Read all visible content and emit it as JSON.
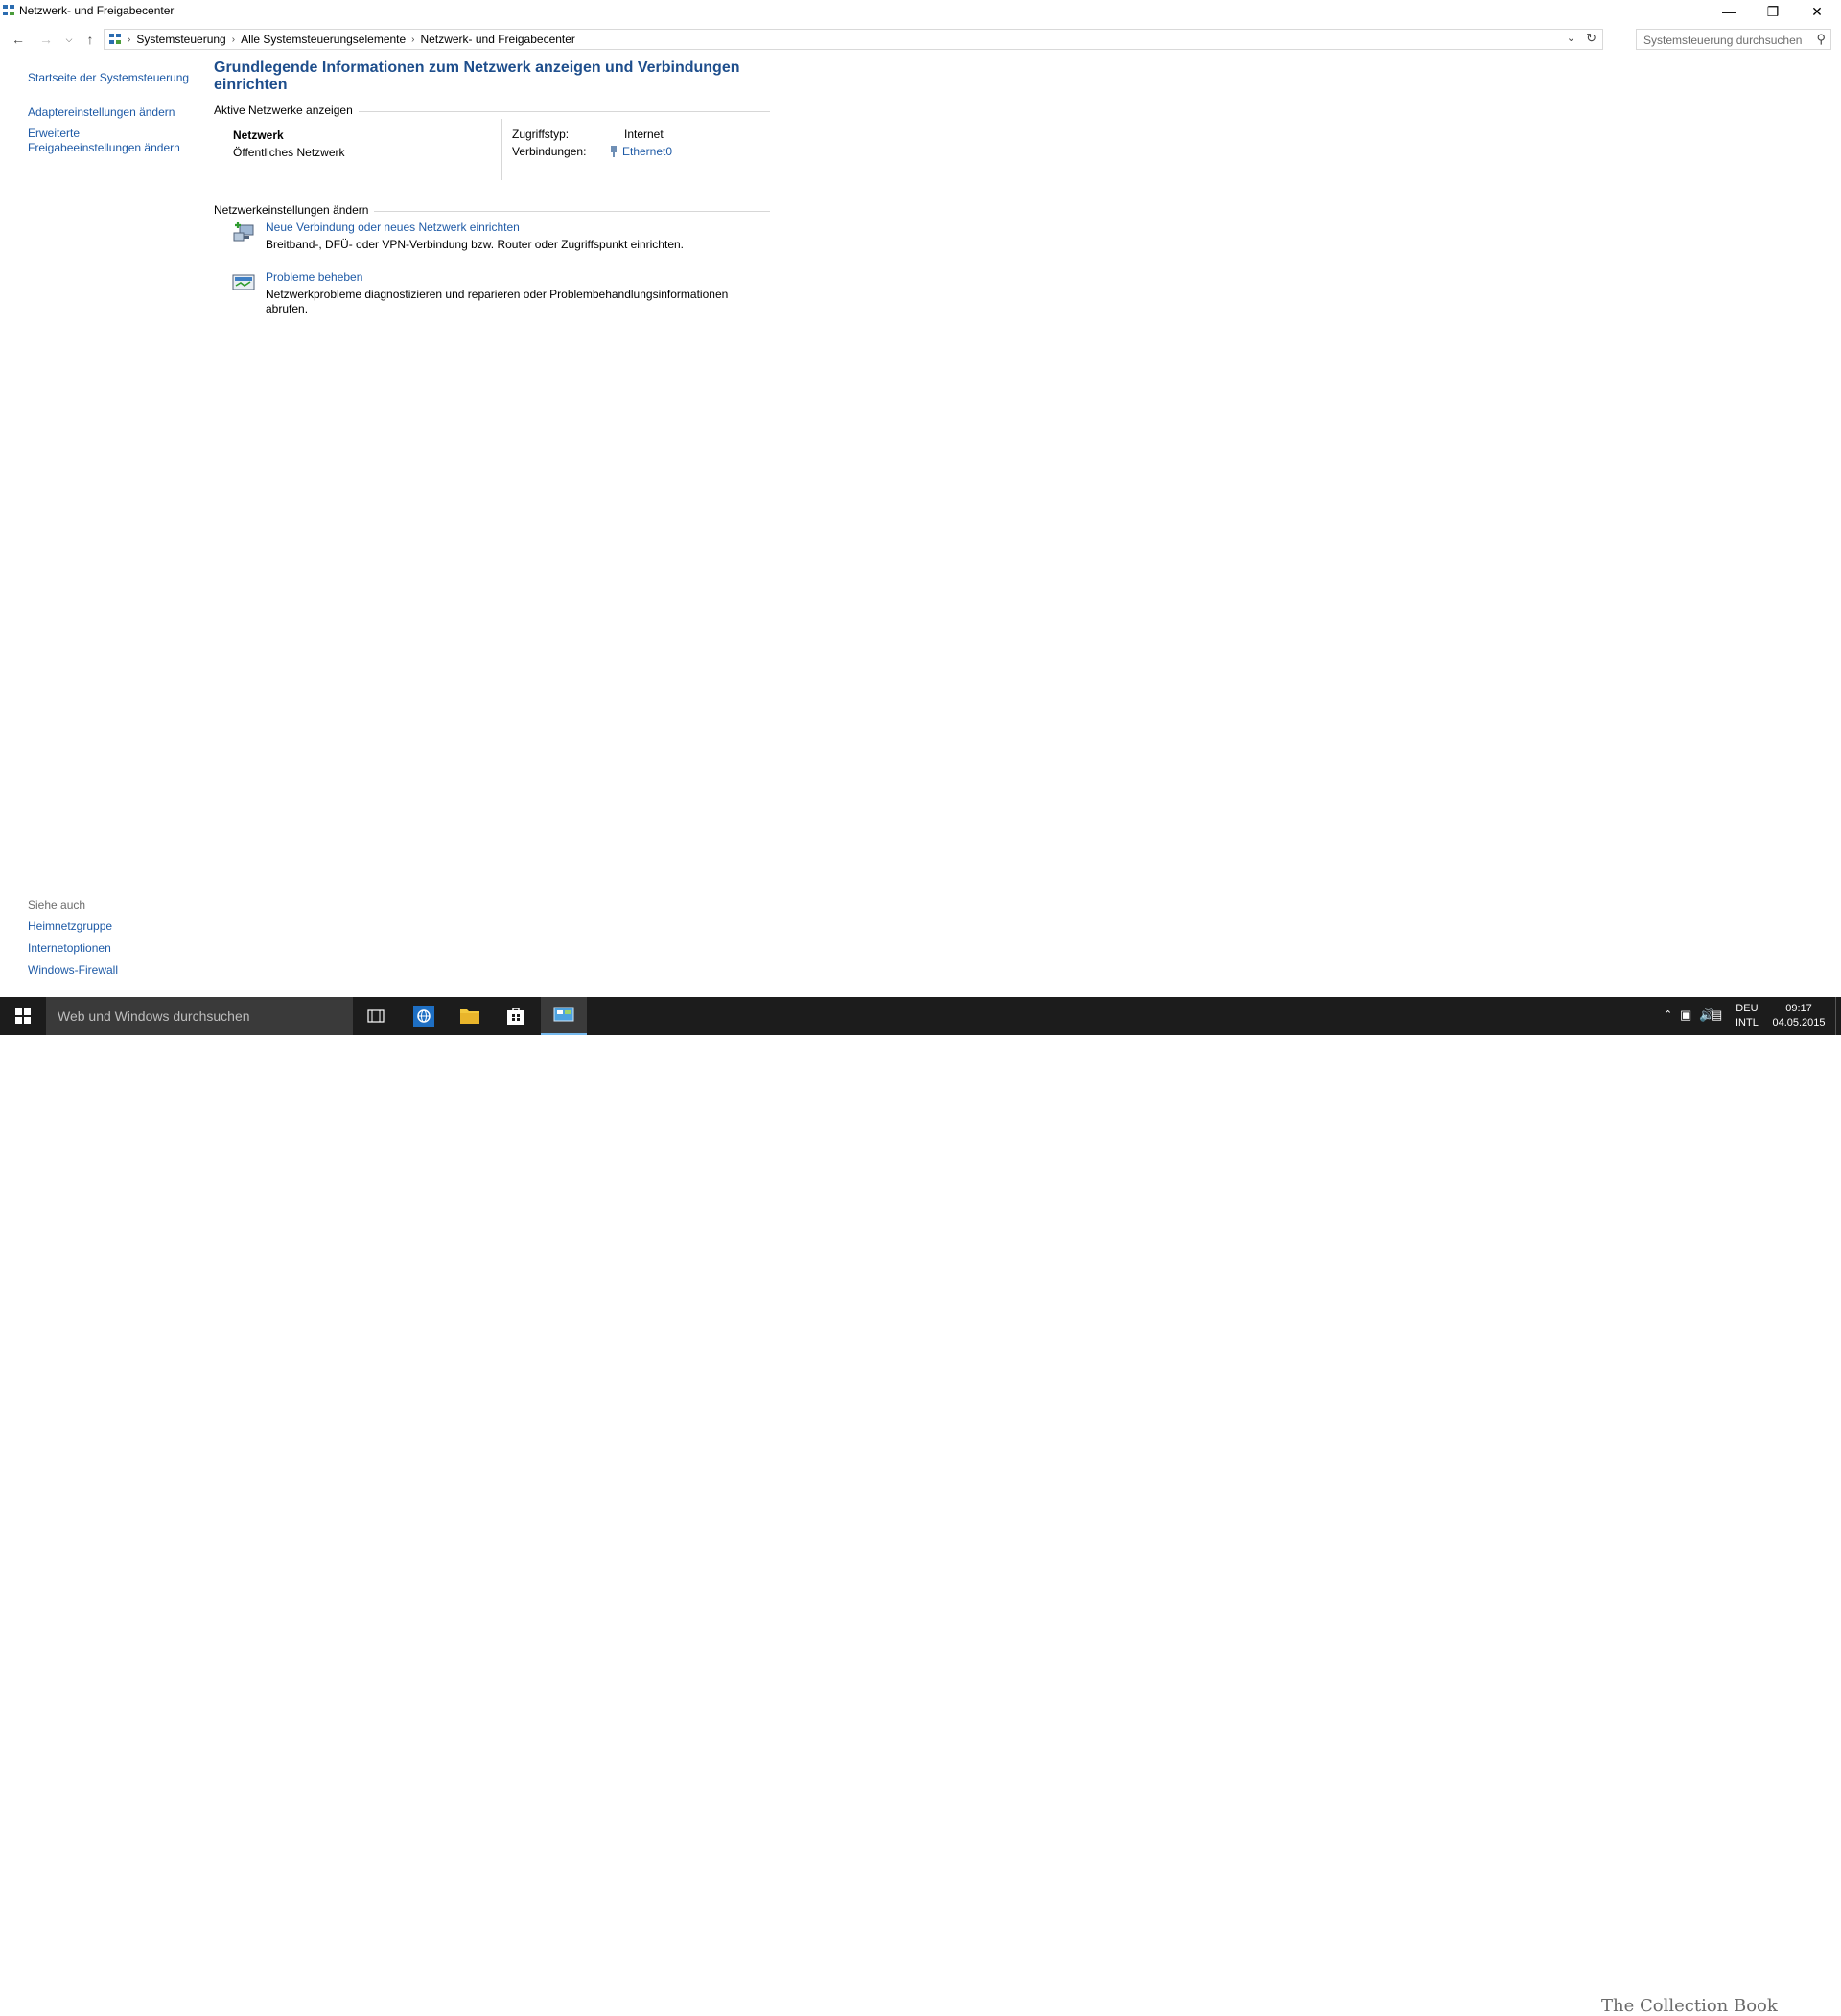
{
  "window": {
    "title": "Netzwerk- und Freigabecenter",
    "controls": [
      "minimize-icon",
      "restore-icon",
      "close-icon"
    ]
  },
  "address": {
    "crumbs": [
      "Systemsteuerung",
      "Alle Systemsteuerungselemente",
      "Netzwerk- und Freigabecenter"
    ],
    "search_placeholder": "Systemsteuerung durchsuchen"
  },
  "left_pane": {
    "links": [
      "Startseite der Systemsteuerung",
      "Adaptereinstellungen ändern",
      "Erweiterte Freigabeeinstellungen ändern"
    ],
    "see_also_header": "Siehe auch",
    "see_also": [
      "Heimnetzgruppe",
      "Internetoptionen",
      "Windows-Firewall"
    ]
  },
  "main": {
    "title": "Grundlegende Informationen zum Netzwerk anzeigen und Verbindungen einrichten",
    "active_header": "Aktive Netzwerke anzeigen",
    "network_name": "Netzwerk",
    "network_type": "Öffentliches Netzwerk",
    "access_label": "Zugriffstyp:",
    "access_value": "Internet",
    "connections_label": "Verbindungen:",
    "connections_value": "Ethernet0",
    "change_header": "Netzwerkeinstellungen ändern",
    "tasks": [
      {
        "title": "Neue Verbindung oder neues Netzwerk einrichten",
        "desc": "Breitband-, DFÜ- oder VPN-Verbindung bzw. Router oder Zugriffspunkt einrichten."
      },
      {
        "title": "Probleme beheben",
        "desc": "Netzwerkprobleme diagnostizieren und reparieren oder Problembehandlungsinformationen abrufen."
      }
    ]
  },
  "taskbar": {
    "search_placeholder": "Web und Windows durchsuchen",
    "lang_top": "DEU",
    "lang_bottom": "INTL",
    "time": "09:17",
    "date": "04.05.2015",
    "watermark": "The Collection Book"
  },
  "colors": {
    "link": "#1e5aa6",
    "title": "#1e4e8c",
    "taskbar": "#1c1c1c"
  }
}
